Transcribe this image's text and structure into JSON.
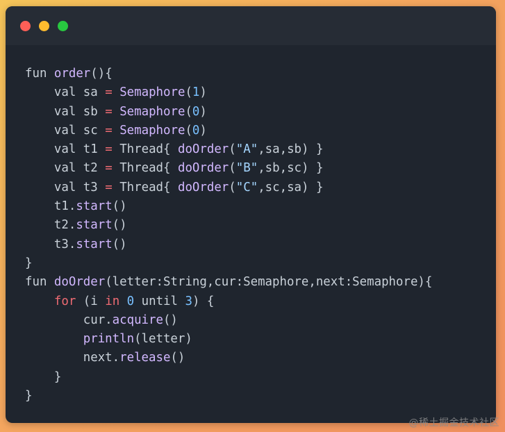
{
  "window": {
    "traffic_lights": [
      "close",
      "minimize",
      "maximize"
    ],
    "colors": {
      "background": "#1f252e",
      "titlebar": "#262c35",
      "close": "#fe5f57",
      "minimize": "#febc2e",
      "maximize": "#28c840"
    }
  },
  "code": {
    "line1": {
      "kw": "fun",
      "fn": "order",
      "rest": "(){"
    },
    "line2": {
      "kw": "val",
      "name": "sa",
      "op": "=",
      "fn": "Semaphore",
      "open": "(",
      "num": "1",
      "close": ")"
    },
    "line3": {
      "kw": "val",
      "name": "sb",
      "op": "=",
      "fn": "Semaphore",
      "open": "(",
      "num": "0",
      "close": ")"
    },
    "line4": {
      "kw": "val",
      "name": "sc",
      "op": "=",
      "fn": "Semaphore",
      "open": "(",
      "num": "0",
      "close": ")"
    },
    "line5": {
      "kw": "val",
      "name": "t1",
      "op": "=",
      "thread": "Thread{",
      "fn": "doOrder",
      "open": "(",
      "str": "\"A\"",
      "args": ",sa,sb)",
      "end": "}"
    },
    "line6": {
      "kw": "val",
      "name": "t2",
      "op": "=",
      "thread": "Thread{",
      "fn": "doOrder",
      "open": "(",
      "str": "\"B\"",
      "args": ",sb,sc)",
      "end": "}"
    },
    "line7": {
      "kw": "val",
      "name": "t3",
      "op": "=",
      "thread": "Thread{",
      "fn": "doOrder",
      "open": "(",
      "str": "\"C\"",
      "args": ",sc,sa)",
      "end": "}"
    },
    "line8": {
      "obj": "t1.",
      "fn": "start",
      "rest": "()"
    },
    "line9": {
      "obj": "t2.",
      "fn": "start",
      "rest": "()"
    },
    "line10": {
      "obj": "t3.",
      "fn": "start",
      "rest": "()"
    },
    "line11": {
      "text": "}"
    },
    "line12": {
      "kw": "fun",
      "fn": "doOrder",
      "rest": "(letter:String,cur:Semaphore,next:Semaphore){"
    },
    "line13": {
      "kw": "for",
      "open": "(i",
      "in": "in",
      "num1": "0",
      "until": "until",
      "num2": "3",
      "rest": ") {"
    },
    "line14": {
      "obj": "cur.",
      "fn": "acquire",
      "rest": "()"
    },
    "line15": {
      "fn": "println",
      "rest": "(letter)"
    },
    "line16": {
      "obj": "next.",
      "fn": "release",
      "rest": "()"
    },
    "line17": {
      "text": "}"
    },
    "line18": {
      "text": "}"
    }
  },
  "watermark": "@稀土掘金技术社区"
}
